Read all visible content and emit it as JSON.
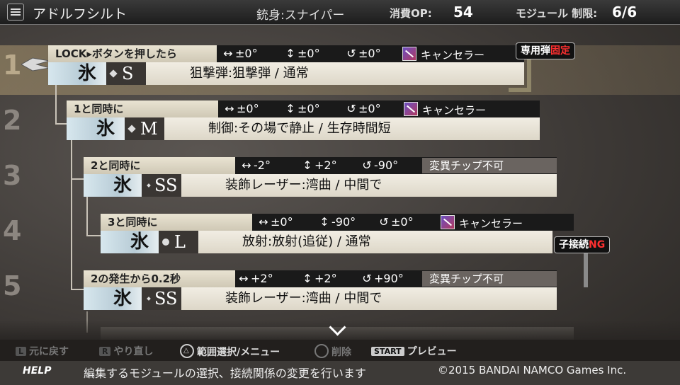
{
  "header": {
    "title": "アドルフシルト",
    "gun": "銃身:スナイパー",
    "op_label": "消費OP:",
    "op_value": "54",
    "module_label": "モジュール 制限:",
    "module_value": "6/6"
  },
  "row_numbers": [
    "1",
    "2",
    "3",
    "4",
    "5"
  ],
  "modules": [
    {
      "label": "LOCK▸ボタンを押したら",
      "h": "±0°",
      "v": "±0°",
      "r": "±0°",
      "chip": "キャンセラー",
      "element": "氷",
      "size": "S",
      "desc": "狙撃弾:狙撃弾 / 通常",
      "tag_prefix": "専用弾",
      "tag_red": "固定"
    },
    {
      "label": "1と同時に",
      "h": "±0°",
      "v": "±0°",
      "r": "±0°",
      "chip": "キャンセラー",
      "element": "氷",
      "size": "M",
      "desc": "制御:その場で静止 / 生存時間短"
    },
    {
      "label": "2と同時に",
      "h": "-2°",
      "v": "+2°",
      "r": "-90°",
      "chip": "変異チップ不可",
      "element": "氷",
      "size": "SS",
      "desc": "装飾レーザー:湾曲 / 中間で"
    },
    {
      "label": "3と同時に",
      "h": "±0°",
      "v": "-90°",
      "r": "±0°",
      "chip": "キャンセラー",
      "element": "氷",
      "size": "L",
      "desc": "放射:放射(追従) / 通常",
      "tag_prefix": "子接続",
      "tag_red": "NG"
    },
    {
      "label": "2の発生から0.2秒",
      "h": "+2°",
      "v": "+2°",
      "r": "+90°",
      "chip": "変異チップ不可",
      "element": "氷",
      "size": "SS",
      "desc": "装飾レーザー:湾曲 / 中間で"
    }
  ],
  "footer": {
    "back": "元に戻す",
    "redo": "やり直し",
    "range": "範囲選択/メニュー",
    "delete": "削除",
    "start_key": "START",
    "preview": "プレビュー",
    "l_key": "L",
    "r_key": "R",
    "help": "HELP",
    "message": "編集するモジュールの選択、接続関係の変更を行います",
    "copyright": "©2015 BANDAI NAMCO Games Inc."
  }
}
